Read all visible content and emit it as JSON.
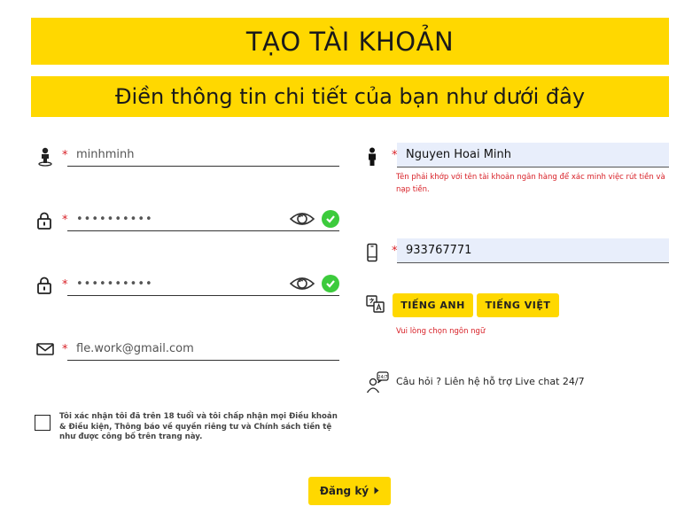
{
  "header": {
    "title": "TẠO TÀI KHOẢN",
    "subtitle": "Điền thông tin chi tiết của bạn như dưới đây"
  },
  "form": {
    "required_mark": "*",
    "username": {
      "value": "minhminh",
      "icon": "user-pin-icon"
    },
    "password": {
      "value": "••••••••••",
      "icon": "lock-icon"
    },
    "confirm_password": {
      "value": "••••••••••",
      "icon": "lock-icon"
    },
    "email": {
      "value": "fle.work@gmail.com",
      "icon": "mail-icon"
    },
    "full_name": {
      "value": "Nguyen Hoai Minh",
      "icon": "person-icon",
      "hint": "Tên phải khớp với tên tài khoản ngân hàng để xác minh việc rút tiền và nạp tiền."
    },
    "phone": {
      "value": "933767771",
      "icon": "phone-icon"
    },
    "language": {
      "icon": "translate-icon",
      "options": [
        "TIẾNG ANH",
        "TIẾNG VIỆT"
      ],
      "hint": "Vui lòng chọn ngôn ngữ"
    },
    "support": {
      "icon": "live-chat-icon",
      "text": "Câu hỏi ? Liên hệ hỗ trợ Live chat 24/7"
    },
    "terms": "Tôi xác nhận tôi đã trên 18 tuổi và tôi chấp nhận mọi Điều khoản & Điều kiện, Thông báo về quyền riêng tư và Chính sách tiền tệ như được công bố trên trang này.",
    "submit_label": "Đăng ký"
  },
  "colors": {
    "accent": "#ffd800",
    "required": "#d81f26",
    "valid": "#3ccb3c",
    "input_fill": "#e8eefb"
  }
}
